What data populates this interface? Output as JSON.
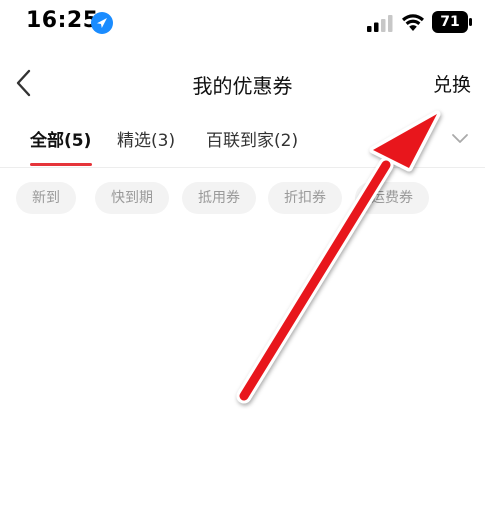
{
  "status_bar": {
    "time": "16:25",
    "battery_level": "71"
  },
  "nav": {
    "title": "我的优惠券",
    "redeem_label": "兑换"
  },
  "tabs": [
    {
      "label": "全部(5)",
      "active": true
    },
    {
      "label": "精选(3)",
      "active": false
    },
    {
      "label": "百联到家(2)",
      "active": false
    }
  ],
  "filters": [
    {
      "label": "新到"
    },
    {
      "label": "快到期"
    },
    {
      "label": "抵用券"
    },
    {
      "label": "折扣券"
    },
    {
      "label": "运费券"
    }
  ],
  "colors": {
    "accent": "#e5343a",
    "annotation_arrow": "#e8181b"
  },
  "icons": {
    "location": "location-arrow-icon",
    "back": "chevron-left-icon",
    "expand": "chevron-down-icon"
  }
}
